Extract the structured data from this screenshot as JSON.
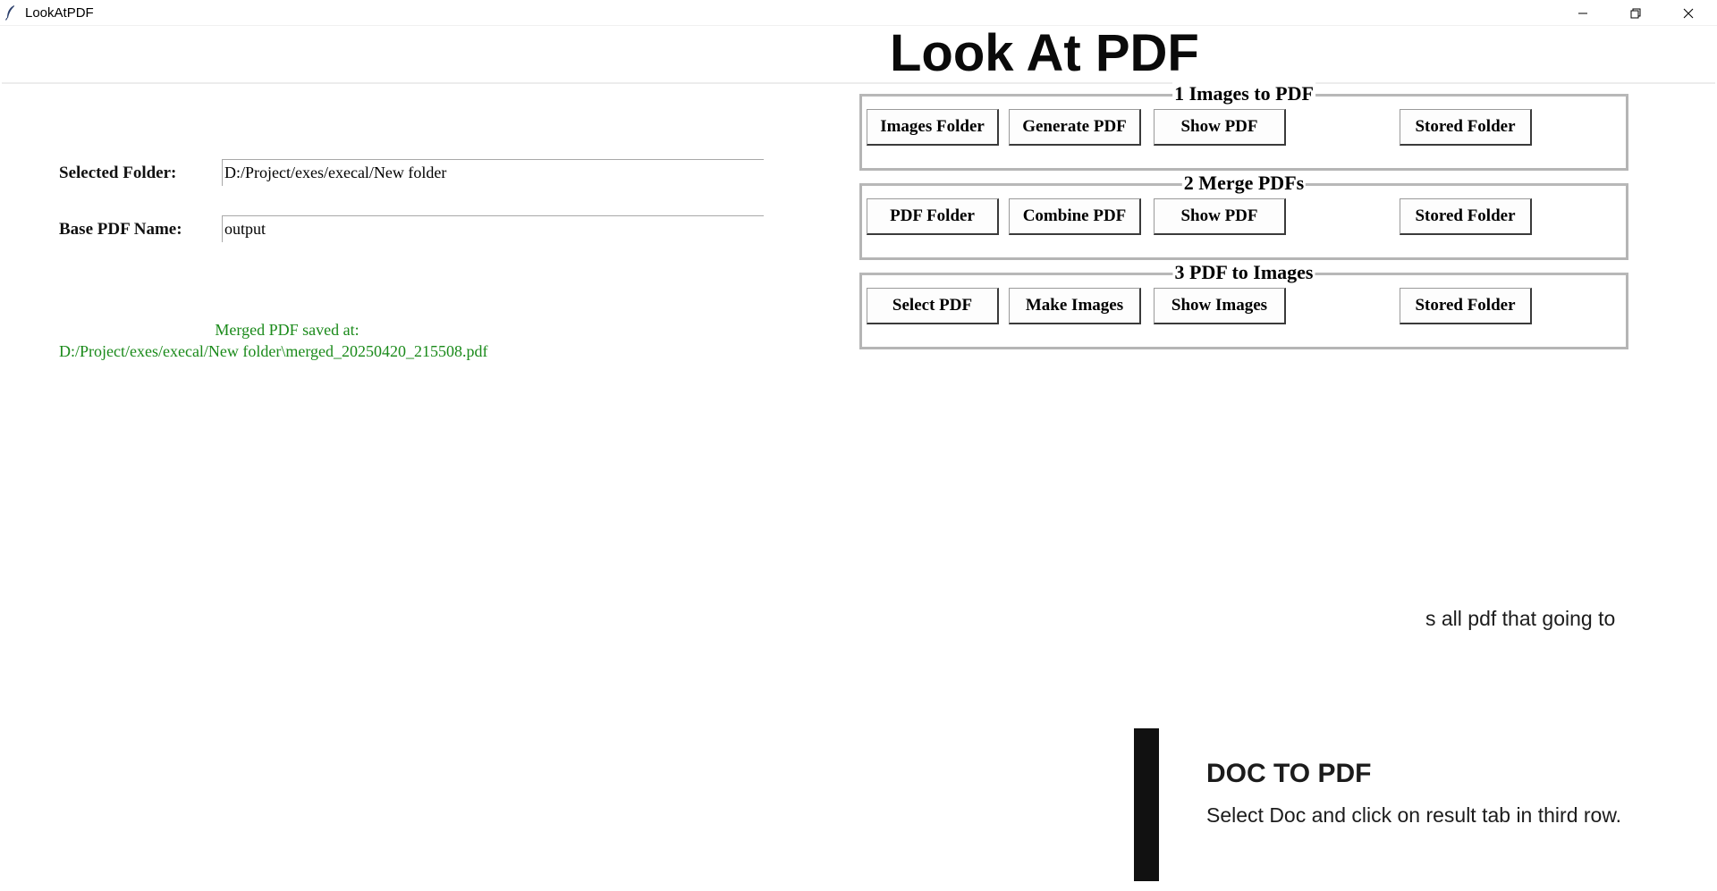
{
  "window": {
    "title": "LookAtPDF",
    "icon": "feather-icon",
    "controls": [
      "minimize-icon",
      "restore-icon",
      "close-icon"
    ]
  },
  "header": {
    "title": "Look At PDF"
  },
  "form": {
    "folder_label": "Selected Folder:",
    "folder_value": "D:/Project/exes/execal/New folder",
    "base_name_label": "Base PDF Name:",
    "base_name_value": "output"
  },
  "status": {
    "line1": "Merged PDF saved at:",
    "line2": "D:/Project/exes/execal/New folder\\merged_20250420_215508.pdf",
    "color": "#1a8a1a"
  },
  "groups": [
    {
      "title": "1 Images to PDF",
      "buttons": [
        "Images Folder",
        "Generate PDF",
        "Show PDF",
        "Stored Folder"
      ]
    },
    {
      "title": "2 Merge PDFs",
      "buttons": [
        "PDF Folder",
        "Combine PDF",
        "Show PDF",
        "Stored Folder"
      ]
    },
    {
      "title": "3 PDF to Images",
      "buttons": [
        "Select PDF",
        "Make Images",
        "Show Images",
        "Stored Folder"
      ]
    }
  ],
  "background_doc": {
    "fragment": "s all pdf that going to",
    "heading": "DOC TO PDF",
    "body": "Select Doc and click on result tab in third row."
  }
}
